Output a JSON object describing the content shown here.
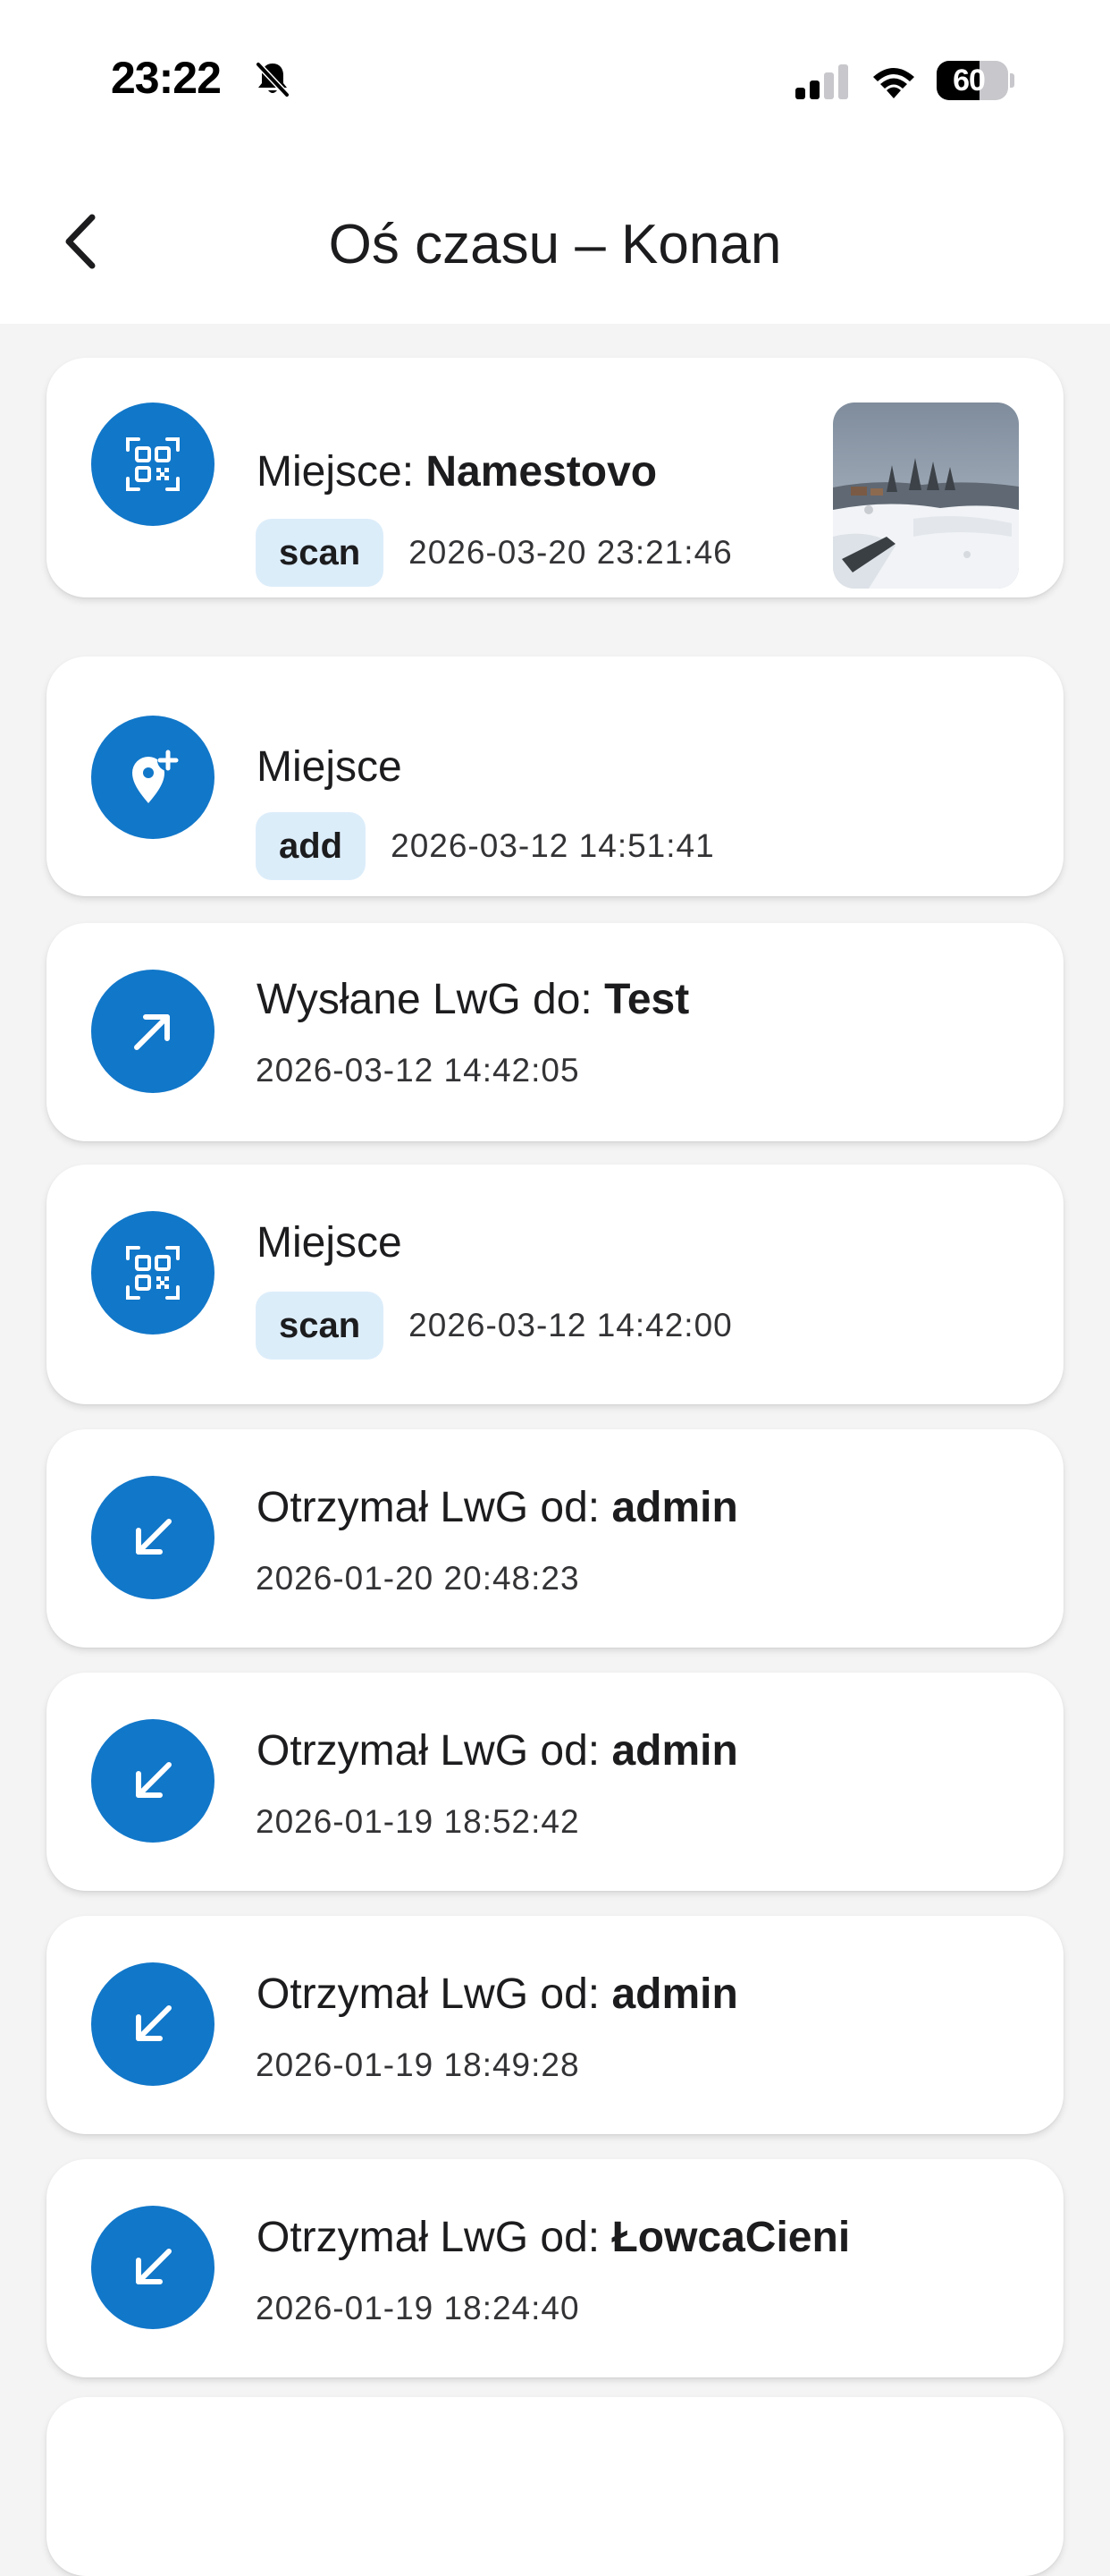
{
  "status_bar": {
    "time": "23:22",
    "battery_level": "60",
    "icons": [
      "bell-slash-icon",
      "cellular-signal-icon",
      "wifi-icon",
      "battery-icon"
    ]
  },
  "header": {
    "title": "Oś czasu – Konan",
    "back_icon": "chevron-left-icon"
  },
  "timeline": [
    {
      "icon": "qr-code-icon",
      "label": "Miejsce",
      "separator": ": ",
      "bold": "Namestovo",
      "tag": "scan",
      "timestamp": "2026-03-20 23:21:46",
      "has_thumbnail": true
    },
    {
      "icon": "map-pin-plus-icon",
      "label": "Miejsce",
      "separator": "",
      "bold": "",
      "tag": "add",
      "timestamp": "2026-03-12 14:51:41",
      "has_thumbnail": false
    },
    {
      "icon": "arrow-up-right-icon",
      "label": "Wysłane LwG do",
      "separator": ": ",
      "bold": "Test",
      "tag": "",
      "timestamp": "2026-03-12 14:42:05",
      "has_thumbnail": false
    },
    {
      "icon": "qr-code-icon",
      "label": "Miejsce",
      "separator": "",
      "bold": "",
      "tag": "scan",
      "timestamp": "2026-03-12 14:42:00",
      "has_thumbnail": false
    },
    {
      "icon": "arrow-down-left-icon",
      "label": "Otrzymał LwG od",
      "separator": ": ",
      "bold": "admin",
      "tag": "",
      "timestamp": "2026-01-20 20:48:23",
      "has_thumbnail": false
    },
    {
      "icon": "arrow-down-left-icon",
      "label": "Otrzymał LwG od",
      "separator": ": ",
      "bold": "admin",
      "tag": "",
      "timestamp": "2026-01-19 18:52:42",
      "has_thumbnail": false
    },
    {
      "icon": "arrow-down-left-icon",
      "label": "Otrzymał LwG od",
      "separator": ": ",
      "bold": "admin",
      "tag": "",
      "timestamp": "2026-01-19 18:49:28",
      "has_thumbnail": false
    },
    {
      "icon": "arrow-down-left-icon",
      "label": "Otrzymał LwG od",
      "separator": ": ",
      "bold": "ŁowcaCieni",
      "tag": "",
      "timestamp": "2026-01-19 18:24:40",
      "has_thumbnail": false
    }
  ],
  "colors": {
    "accent": "#1177c9",
    "tag_background": "#dcedfa",
    "page_background": "#f4f4f4",
    "card_background": "#ffffff"
  }
}
